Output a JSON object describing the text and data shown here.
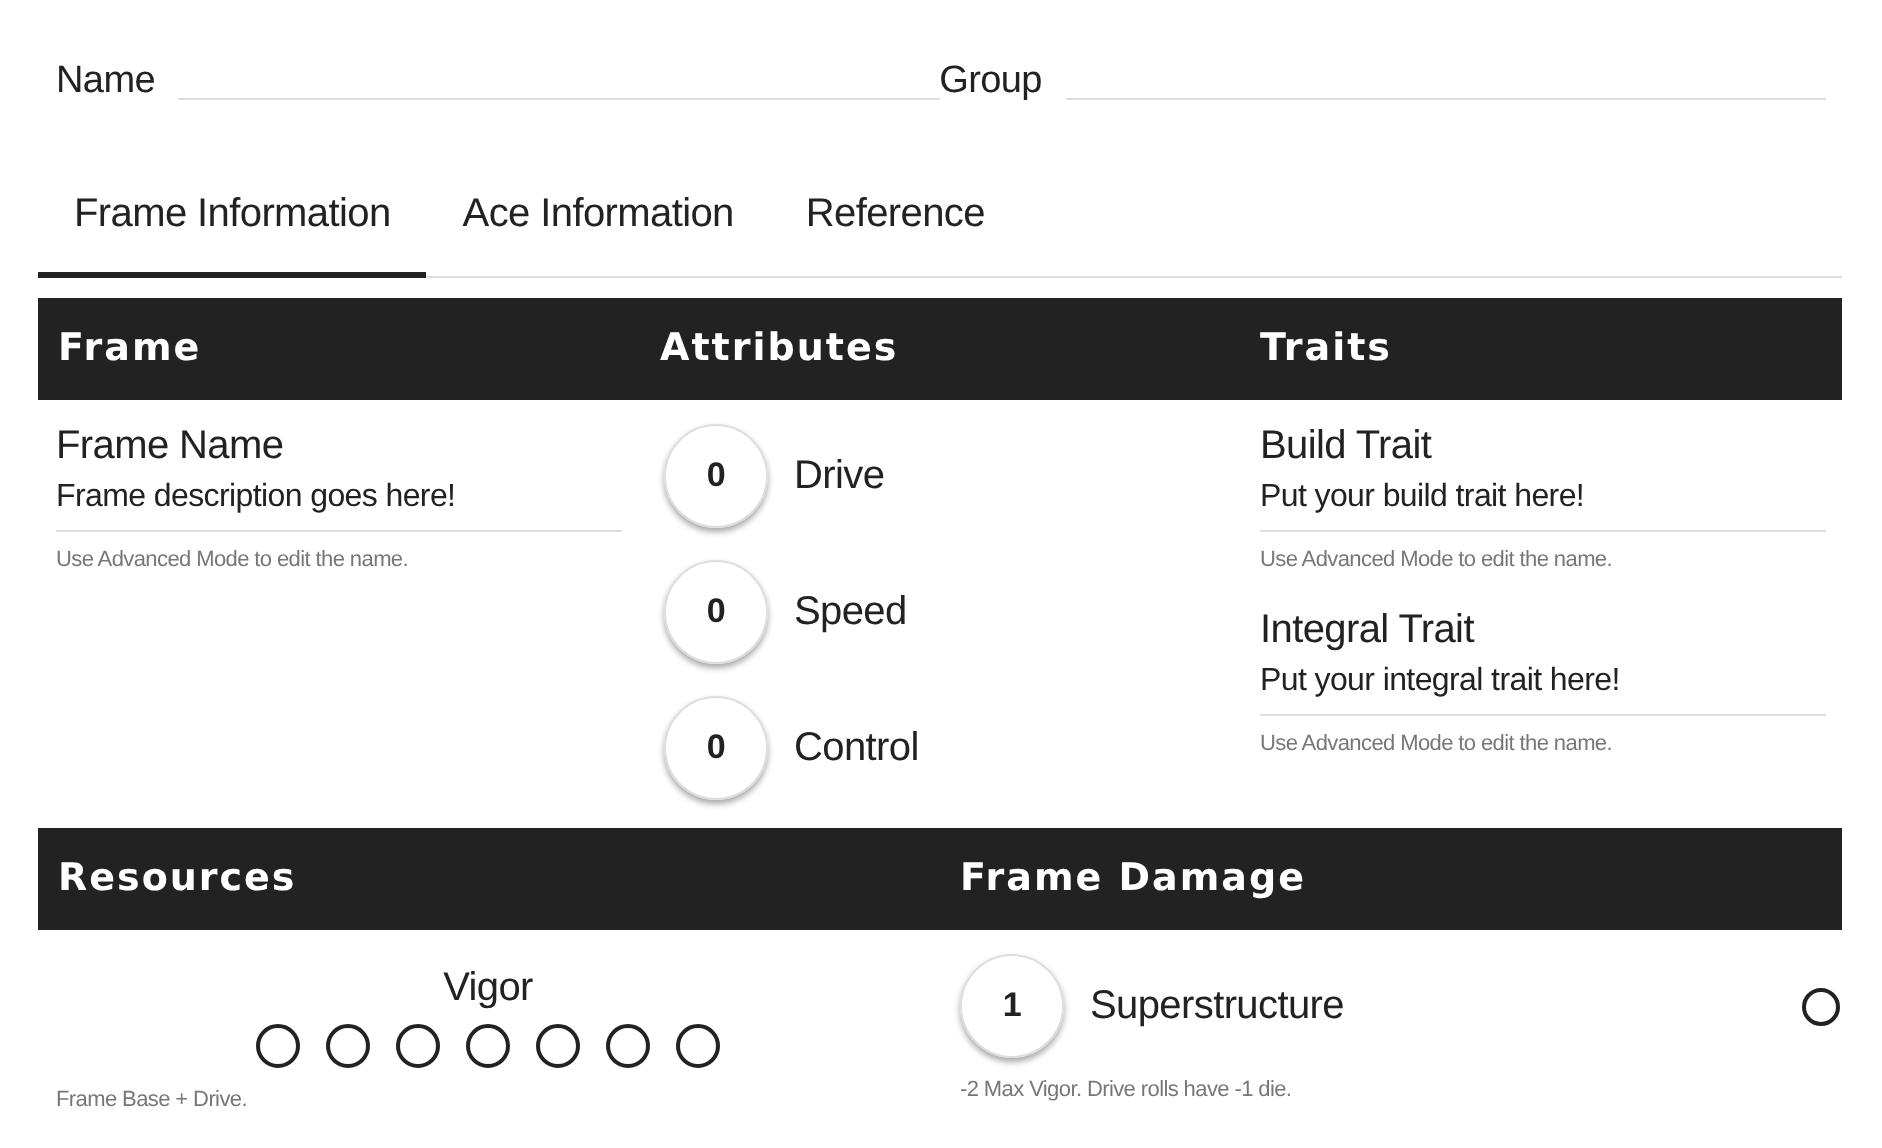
{
  "top_fields": [
    {
      "label": "Name"
    },
    {
      "label": "Group"
    }
  ],
  "tabs": [
    {
      "label": "Frame Information",
      "selected": true
    },
    {
      "label": "Ace Information",
      "selected": false
    },
    {
      "label": "Reference",
      "selected": false
    }
  ],
  "frame": {
    "heading": "Frame",
    "name": "Frame Name",
    "description": "Frame description goes here!",
    "hint": "Use Advanced Mode to edit the name."
  },
  "attributes": {
    "heading": "Attributes",
    "items": [
      {
        "value": "0",
        "label": "Drive"
      },
      {
        "value": "0",
        "label": "Speed"
      },
      {
        "value": "0",
        "label": "Control"
      }
    ]
  },
  "traits": {
    "heading": "Traits",
    "items": [
      {
        "name": "Build Trait",
        "description": "Put your build trait here!",
        "hint": "Use Advanced Mode to edit the name."
      },
      {
        "name": "Integral Trait",
        "description": "Put your integral trait here!",
        "hint": "Use Advanced Mode to edit the name."
      }
    ]
  },
  "resources": {
    "heading": "Resources",
    "vigor": {
      "label": "Vigor",
      "boxes": [
        {
          "checked": false
        },
        {
          "checked": false
        },
        {
          "checked": false
        },
        {
          "checked": false
        },
        {
          "checked": false
        },
        {
          "checked": false
        },
        {
          "checked": false
        }
      ],
      "note": "Frame Base + Drive."
    }
  },
  "frame_damage": {
    "heading": "Frame Damage",
    "items": [
      {
        "value": "1",
        "label": "Superstructure",
        "checked": false,
        "note": "-2 Max Vigor. Drive rolls have -1 die."
      }
    ]
  }
}
